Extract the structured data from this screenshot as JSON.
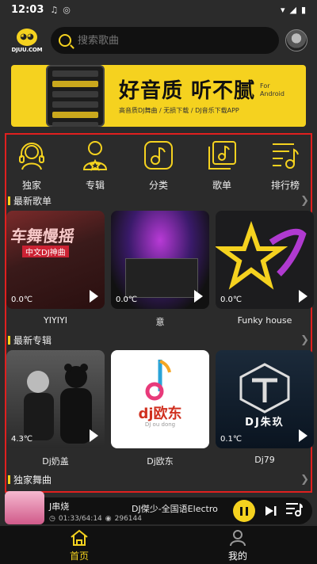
{
  "status": {
    "time": "12:03"
  },
  "header": {
    "logo_text": "DJUU.COM",
    "search_placeholder": "搜索歌曲"
  },
  "banner": {
    "title": "好音质 听不腻",
    "for_text_1": "For",
    "for_text_2": "Android",
    "subtitle": "高音质DJ舞曲 / 无损下载 / DJ音乐下载APP"
  },
  "categories": [
    {
      "label": "独家",
      "icon": "headphones-icon"
    },
    {
      "label": "专辑",
      "icon": "user-star-icon"
    },
    {
      "label": "分类",
      "icon": "music-note-icon"
    },
    {
      "label": "歌单",
      "icon": "playlist-icon"
    },
    {
      "label": "排行榜",
      "icon": "ranking-icon"
    }
  ],
  "sections": {
    "latest_playlists": "最新歌单",
    "latest_albums": "最新专辑",
    "exclusive": "独家舞曲"
  },
  "playlists": [
    {
      "title": "YIYIYI",
      "temp": "0.0℃",
      "art_text_1": "车舞慢摇",
      "art_text_2": "中文DJ神曲"
    },
    {
      "title": "意",
      "temp": "0.0℃"
    },
    {
      "title": "Funky house",
      "temp": "0.0℃"
    }
  ],
  "albums": [
    {
      "title": "Dj奶盖",
      "temp": "4.3℃"
    },
    {
      "title": "Dj欧东",
      "art_text": "dj欧东",
      "art_sub": "DJ ou dong"
    },
    {
      "title": "Dj79",
      "temp": "0.1℃",
      "art_text": "DJ朱玖"
    }
  ],
  "player": {
    "artist": "J串烧",
    "title": "DJ傑少-全国语Electro",
    "time": "01:33/64:14",
    "plays": "296144"
  },
  "nav": [
    {
      "label": "首页"
    },
    {
      "label": "我的"
    }
  ],
  "colors": {
    "accent": "#f5d21f",
    "highlight_border": "#e0201f",
    "background": "#2b2b2b"
  }
}
